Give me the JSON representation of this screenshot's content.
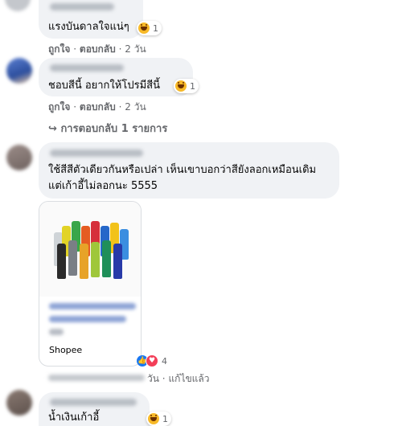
{
  "comments": [
    {
      "text": "แรงบันดาลใจแน่ๆ",
      "reaction_count": "1",
      "actions": {
        "like": "ถูกใจ",
        "reply": "ตอบกลับ",
        "age": "2 วัน"
      }
    },
    {
      "text": "ชอบสีนี้ อยากให้โปรมีสีนี้",
      "reaction_count": "1",
      "actions": {
        "like": "ถูกใจ",
        "reply": "ตอบกลับ",
        "age": "2 วัน"
      },
      "replies_label": "การตอบกลับ 1 รายการ"
    },
    {
      "text_line1": "ใช้สีสีตัวเดียวกันหรือเปล่า เห็นเขาบอกว่าสียังลอกเหมือนเดิม",
      "text_line2": "แต่เก้าอี้ไม่ลอกนะ 5555",
      "link_card": {
        "source": "Shopee"
      },
      "reaction_count": "4",
      "actions": {
        "age": "วัน",
        "edited": "แก้ไขแล้ว"
      }
    },
    {
      "text": "น้ำเงินเก้าอี้",
      "reaction_count": "1"
    }
  ],
  "separator": "·",
  "reply_arrow": "↪",
  "colors": {
    "bubble": "#f0f2f5",
    "meta": "#65676b",
    "like_blue": "#1877f2",
    "love_red": "#f33e58",
    "haha_yellow": "#f7b928"
  }
}
